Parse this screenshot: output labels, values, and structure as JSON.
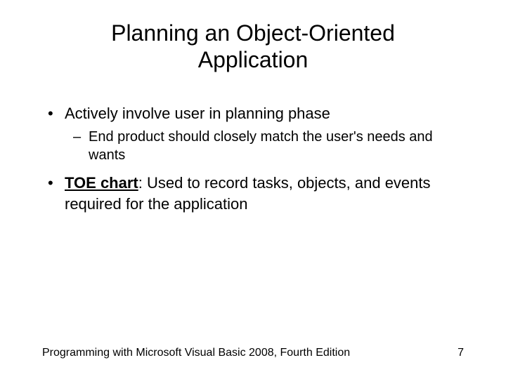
{
  "title": "Planning an Object-Oriented Application",
  "bullets": {
    "b1": "Actively involve user in planning phase",
    "b1_sub1": "End product should closely match the user's needs and wants",
    "b2_lead": "TOE chart",
    "b2_rest": ": Used to record tasks, objects, and events required for the application"
  },
  "footer": {
    "left": "Programming with Microsoft Visual Basic 2008, Fourth Edition",
    "right": "7"
  }
}
